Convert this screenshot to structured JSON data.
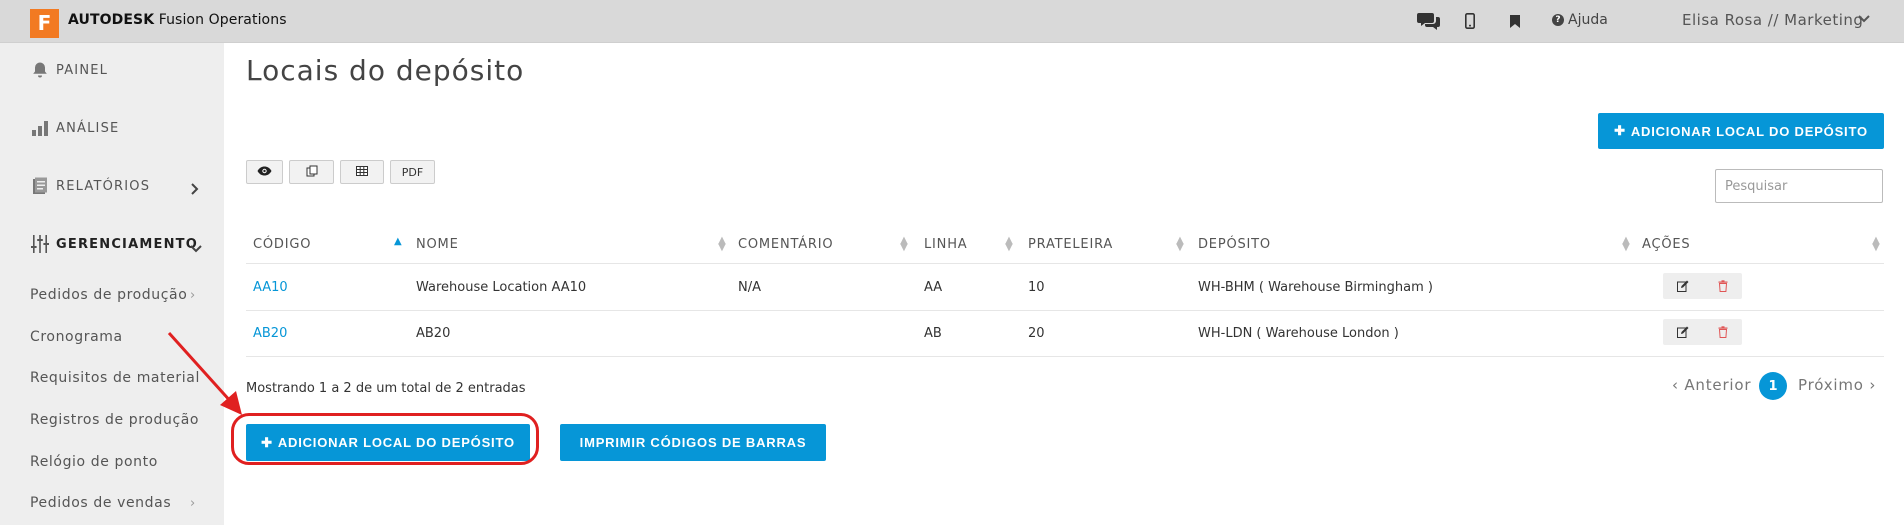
{
  "app": {
    "logo_letter": "F",
    "brand_bold": "AUTODESK",
    "brand_rest": " Fusion Operations"
  },
  "topbar": {
    "help_label": "Ajuda",
    "user_label": "Elisa Rosa // Marketing",
    "icons": [
      "chat-icon",
      "mobile-icon",
      "bookmark-icon",
      "help-icon"
    ]
  },
  "sidebar": {
    "items": [
      {
        "label": "PAINEL",
        "icon": "bell-icon"
      },
      {
        "label": "ANÁLISE",
        "icon": "bar-chart-icon"
      },
      {
        "label": "RELATÓRIOS",
        "icon": "report-icon"
      },
      {
        "label": "GERENCIAMENTO",
        "icon": "sliders-icon"
      }
    ],
    "subitems": [
      {
        "label": "Pedidos de produção"
      },
      {
        "label": "Cronograma"
      },
      {
        "label": "Requisitos de material"
      },
      {
        "label": "Registros de produção"
      },
      {
        "label": "Relógio de ponto"
      },
      {
        "label": "Pedidos de vendas"
      }
    ]
  },
  "main": {
    "title": "Locais do depósito",
    "add_top_label": "ADICIONAR LOCAL DO DEPÓSITO",
    "toolbar": {
      "pdf_label": "PDF"
    },
    "search_placeholder": "Pesquisar",
    "columns": [
      "CÓDIGO",
      "NOME",
      "COMENTÁRIO",
      "LINHA",
      "PRATELEIRA",
      "DEPÓSITO",
      "AÇÕES"
    ],
    "rows": [
      {
        "code": "AA10",
        "name": "Warehouse Location AA10",
        "comment": "N/A",
        "line": "AA",
        "shelf": "10",
        "warehouse": "WH-BHM ( Warehouse Birmingham )"
      },
      {
        "code": "AB20",
        "name": "AB20",
        "comment": "",
        "line": "AB",
        "shelf": "20",
        "warehouse": "WH-LDN ( Warehouse London )"
      }
    ],
    "info": "Mostrando 1 a 2 de um total de 2 entradas",
    "pager": {
      "prev": "Anterior",
      "current": "1",
      "next": "Próximo"
    },
    "add_bottom_label": "ADICIONAR LOCAL DO DEPÓSITO",
    "print_label": "IMPRIMIR CÓDIGOS DE BARRAS"
  },
  "colors": {
    "accent": "#0696d7",
    "brand": "#f27a22",
    "annotation": "#e02020"
  }
}
